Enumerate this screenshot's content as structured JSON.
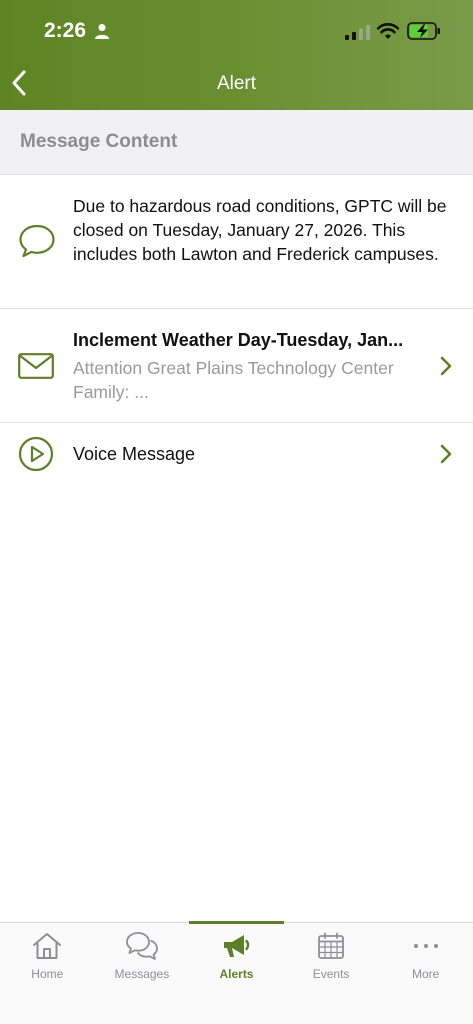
{
  "status_bar": {
    "time": "2:26"
  },
  "nav": {
    "title": "Alert"
  },
  "section": {
    "title": "Message Content"
  },
  "message": {
    "body": "Due to hazardous road conditions, GPTC will be closed on Tuesday, January 27, 2026. This includes both Lawton and Frederick campuses."
  },
  "email_item": {
    "title": "Inclement Weather Day-Tuesday, Jan...",
    "subtitle": "Attention Great Plains Technology Center Family: ..."
  },
  "voice_item": {
    "label": "Voice Message"
  },
  "tabs": [
    {
      "label": "Home",
      "icon": "home-icon"
    },
    {
      "label": "Messages",
      "icon": "messages-icon"
    },
    {
      "label": "Alerts",
      "icon": "megaphone-icon",
      "active": true
    },
    {
      "label": "Events",
      "icon": "calendar-icon"
    },
    {
      "label": "More",
      "icon": "more-icon"
    }
  ],
  "colors": {
    "brand_green": "#5e7f2a",
    "header_gradient_start": "#5e8424",
    "header_gradient_end": "#7a9b4a",
    "inactive_gray": "#8e8e93"
  }
}
